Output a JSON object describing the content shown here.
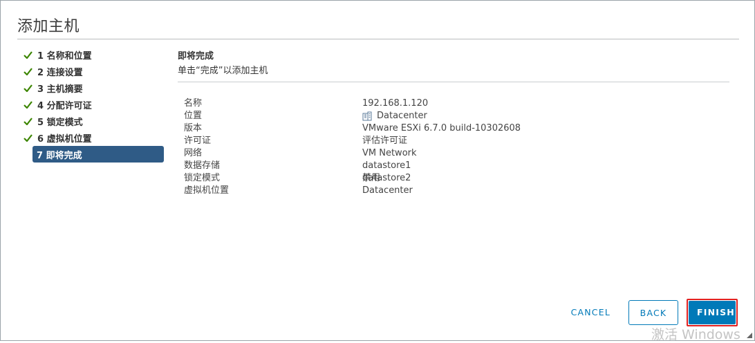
{
  "dialog": {
    "title": "添加主机"
  },
  "steps": [
    {
      "label": "1 名称和位置",
      "done": true
    },
    {
      "label": "2 连接设置",
      "done": true
    },
    {
      "label": "3 主机摘要",
      "done": true
    },
    {
      "label": "4 分配许可证",
      "done": true
    },
    {
      "label": "5 锁定模式",
      "done": true
    },
    {
      "label": "6 虚拟机位置",
      "done": true
    },
    {
      "label": "7 即将完成",
      "done": false,
      "active": true
    }
  ],
  "content": {
    "title": "即将完成",
    "subtitle": "单击“完成”以添加主机"
  },
  "summary": {
    "name_key": "名称",
    "name_val": "192.168.1.120",
    "location_key": "位置",
    "location_val": "Datacenter",
    "location_icon": "datacenter-icon",
    "version_key": "版本",
    "version_val": "VMware ESXi 6.7.0 build-10302608",
    "license_key": "许可证",
    "license_val": "评估许可证",
    "network_key": "网络",
    "network_val": "VM Network",
    "datastore_key": "数据存储",
    "datastore_val1": "datastore1",
    "datastore_val2": "datastore2",
    "lockdown_key": "锁定模式",
    "lockdown_val": "禁用",
    "vmlocation_key": "虚拟机位置",
    "vmlocation_val": "Datacenter"
  },
  "buttons": {
    "cancel": "CANCEL",
    "back": "BACK",
    "finish": "FINISH"
  },
  "watermark": "激活 Windows",
  "colors": {
    "accent": "#0079b8",
    "active_step": "#2f5b86",
    "check": "#3c8500",
    "highlight": "#e02020"
  }
}
